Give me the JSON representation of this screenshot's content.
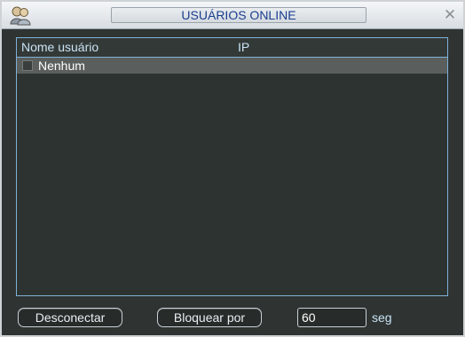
{
  "window": {
    "title": "USUÁRIOS ONLINE",
    "icons": {
      "app": "users-icon",
      "close": "close-icon"
    }
  },
  "list": {
    "columns": [
      "Nome usuário",
      "IP"
    ],
    "rows": [
      {
        "name": "Nenhum",
        "ip": "",
        "checked": false
      }
    ]
  },
  "controls": {
    "disconnect_label": "Desconectar",
    "block_label": "Bloquear por",
    "block_seconds": "60",
    "seconds_unit": "seg"
  },
  "colors": {
    "title_text": "#1a3d8f",
    "panel_bg": "#2f3432",
    "list_border": "#7fb0d8",
    "selected_row": "#5a5f5d"
  }
}
